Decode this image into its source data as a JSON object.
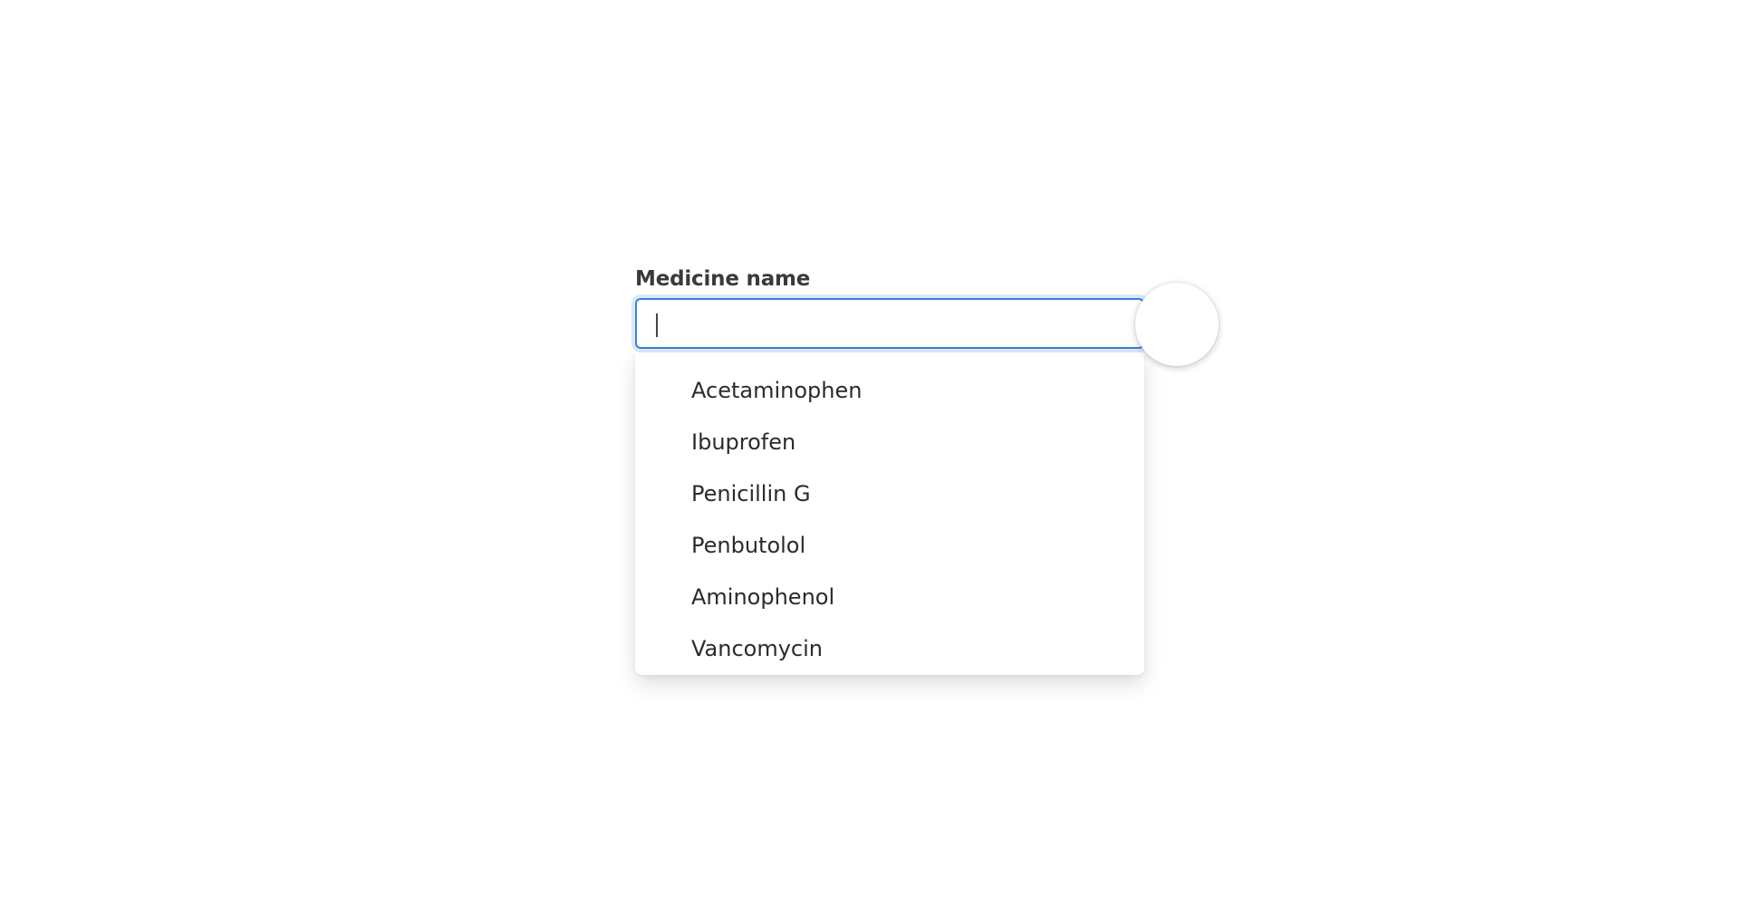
{
  "form": {
    "label": "Medicine name",
    "input_value": "",
    "input_placeholder": ""
  },
  "dropdown": {
    "options": [
      "Acetaminophen",
      "Ibuprofen",
      "Penicillin G",
      "Penbutolol",
      "Aminophenol",
      "Vancomycin"
    ]
  },
  "colors": {
    "focus_border": "#3b7fdc",
    "text": "#2b2b2b",
    "label": "#3a3a3a",
    "background": "#ffffff"
  }
}
